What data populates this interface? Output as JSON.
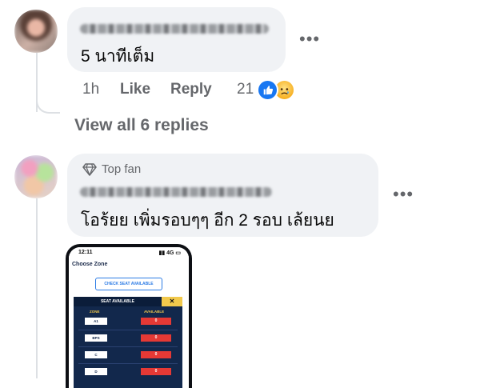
{
  "comments": [
    {
      "author_blurred": true,
      "text": "5 นาทีเต็ม",
      "time": "1h",
      "like_label": "Like",
      "reply_label": "Reply",
      "reaction_count": "21",
      "reactions": [
        "like-icon",
        "sad-icon"
      ],
      "more_icon": "more-horizontal-icon"
    },
    {
      "badge": "Top fan",
      "badge_icon": "diamond-icon",
      "author_blurred": true,
      "text": "โอร้ยย เพิ่มรอบๆๆ อีก 2 รอบ เล้ยนย",
      "more_icon": "more-horizontal-icon",
      "attachment": {
        "status_time": "12:11",
        "status_icons": "▮▮ 4G ▭",
        "title": "Choose Zone",
        "check_button": "CHECK SEAT AVAILABLE",
        "panel_header": "SEAT AVAILABLE",
        "close_symbol": "✕",
        "col_zone": "ZONE",
        "col_available": "AVAILABLE",
        "rows": [
          {
            "zone": "A1",
            "available": "0"
          },
          {
            "zone": "BPS",
            "available": "0"
          },
          {
            "zone": "C",
            "available": "0"
          },
          {
            "zone": "D",
            "available": "0"
          }
        ]
      }
    }
  ],
  "view_replies": "View all 6 replies",
  "colors": {
    "bubble": "#f0f2f5",
    "secondary_text": "#65676b",
    "like_blue": "#1877f2"
  }
}
